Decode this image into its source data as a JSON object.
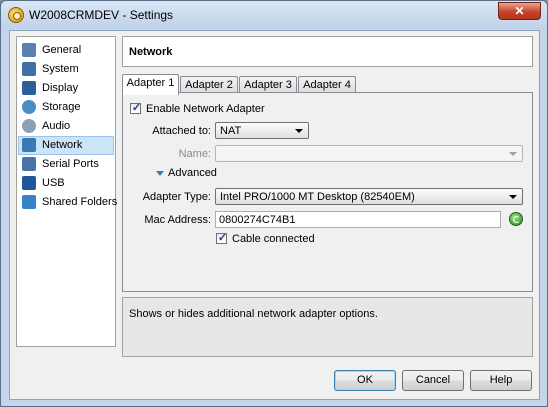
{
  "window": {
    "title": "W2008CRMDEV - Settings",
    "close_label": "✕"
  },
  "sidebar": {
    "items": [
      {
        "label": "General",
        "icon": "general-icon",
        "color": "#5a7fb0"
      },
      {
        "label": "System",
        "icon": "system-icon",
        "color": "#3f6fa6"
      },
      {
        "label": "Display",
        "icon": "display-icon",
        "color": "#2c5f9a"
      },
      {
        "label": "Storage",
        "icon": "storage-icon",
        "color": "#4a8cc4"
      },
      {
        "label": "Audio",
        "icon": "audio-icon",
        "color": "#8aa0b6"
      },
      {
        "label": "Network",
        "icon": "network-icon",
        "color": "#3b78b8"
      },
      {
        "label": "Serial Ports",
        "icon": "serial-ports-icon",
        "color": "#4a74a8"
      },
      {
        "label": "USB",
        "icon": "usb-icon",
        "color": "#22569b"
      },
      {
        "label": "Shared Folders",
        "icon": "shared-folders-icon",
        "color": "#3a82c8"
      }
    ],
    "selected": "Network"
  },
  "page": {
    "title": "Network"
  },
  "tabs": [
    "Adapter 1",
    "Adapter 2",
    "Adapter 3",
    "Adapter 4"
  ],
  "adapter": {
    "enable_label": "Enable Network Adapter",
    "enabled": true,
    "attached_label": "Attached to:",
    "attached_value": "NAT",
    "name_label": "Name:",
    "name_value": "",
    "advanced_label": "Advanced",
    "type_label": "Adapter Type:",
    "type_value": "Intel PRO/1000 MT Desktop (82540EM)",
    "mac_label": "Mac Address:",
    "mac_value": "0800274C74B1",
    "cable_label": "Cable connected",
    "cable_connected": true
  },
  "info": {
    "text": "Shows or hides additional network adapter options."
  },
  "buttons": {
    "ok": "OK",
    "cancel": "Cancel",
    "help": "Help"
  }
}
